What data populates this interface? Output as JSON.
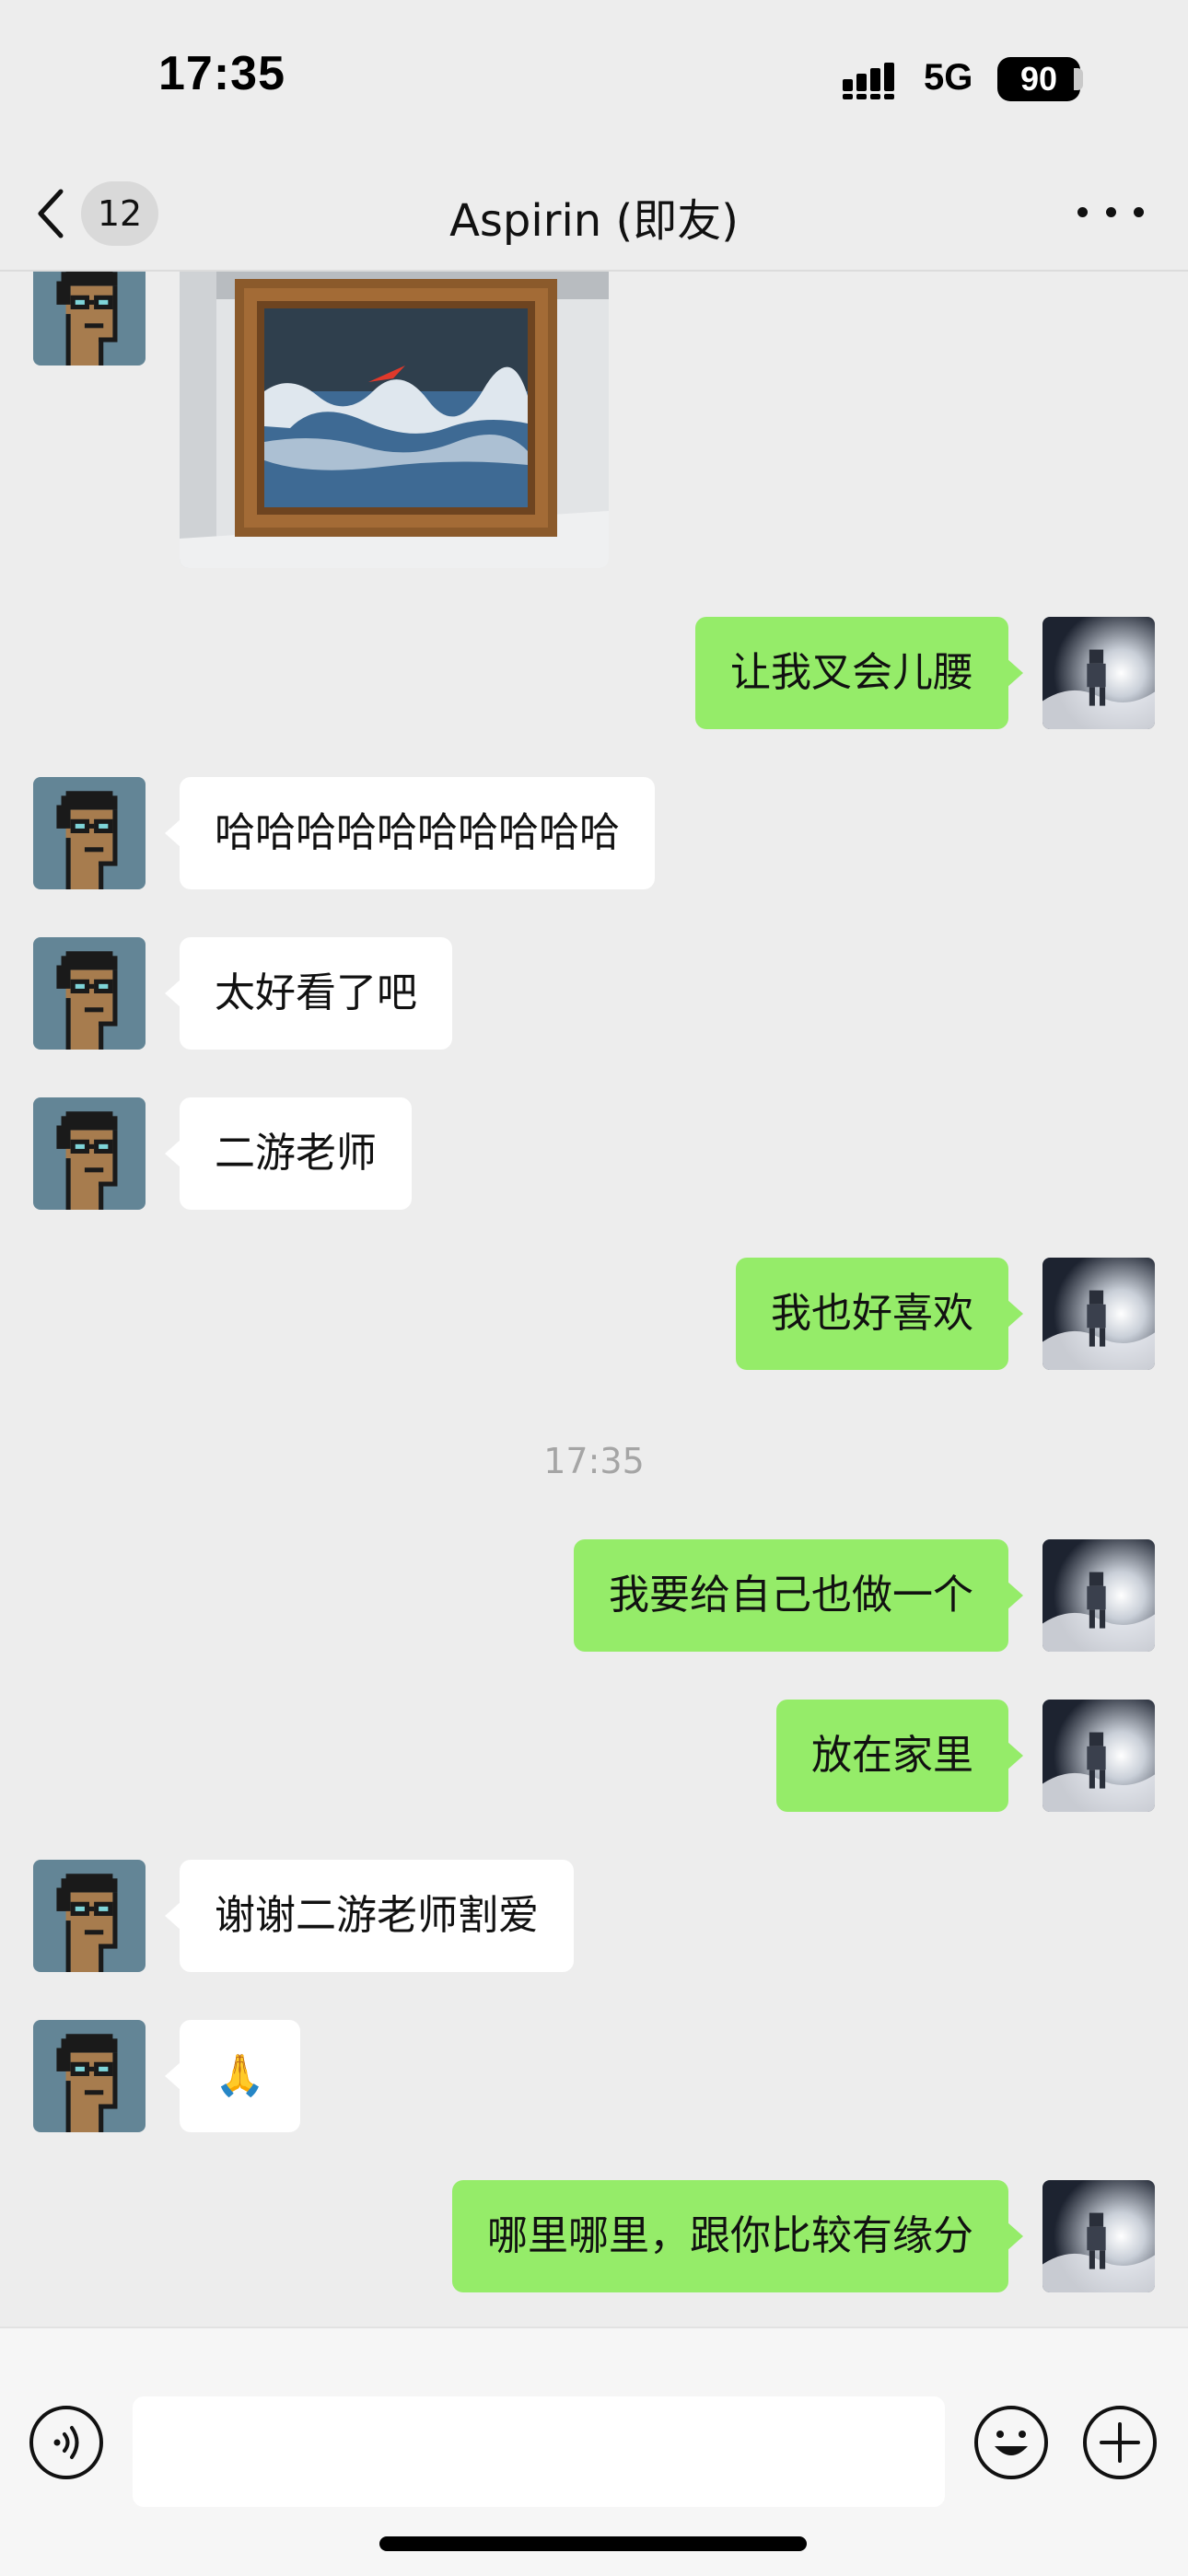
{
  "status_bar": {
    "time": "17:35",
    "network": "5G",
    "battery": "90"
  },
  "header": {
    "unread_count": "12",
    "title": "Aspirin (即友)"
  },
  "messages": {
    "photo": {
      "sender": "Aspirin",
      "type": "image"
    },
    "m1": {
      "direction": "out",
      "text": "让我叉会儿腰"
    },
    "m2": {
      "direction": "in",
      "text": "哈哈哈哈哈哈哈哈哈哈"
    },
    "m3": {
      "direction": "in",
      "text": "太好看了吧"
    },
    "m4": {
      "direction": "in",
      "text": "二游老师"
    },
    "m5": {
      "direction": "out",
      "text": "我也好喜欢"
    },
    "timestamp": "17:35",
    "m6": {
      "direction": "out",
      "text": "我要给自己也做一个"
    },
    "m7": {
      "direction": "out",
      "text": "放在家里"
    },
    "m8": {
      "direction": "in",
      "text": "谢谢二游老师割爱"
    },
    "m9": {
      "direction": "in",
      "text": "🙏"
    },
    "m10": {
      "direction": "out",
      "text": "哪里哪里，跟你比较有缘分"
    }
  },
  "input": {
    "value": "",
    "placeholder": ""
  },
  "colors": {
    "background": "#ededed",
    "outgoing_bubble": "#95ec69",
    "incoming_bubble": "#ffffff",
    "timestamp_text": "#a5a5a5"
  },
  "icons": {
    "back": "chevron-left-icon",
    "more": "more-dots-icon",
    "voice": "voice-icon",
    "emoji": "emoji-icon",
    "plus": "plus-icon",
    "signal": "signal-bars-icon"
  }
}
